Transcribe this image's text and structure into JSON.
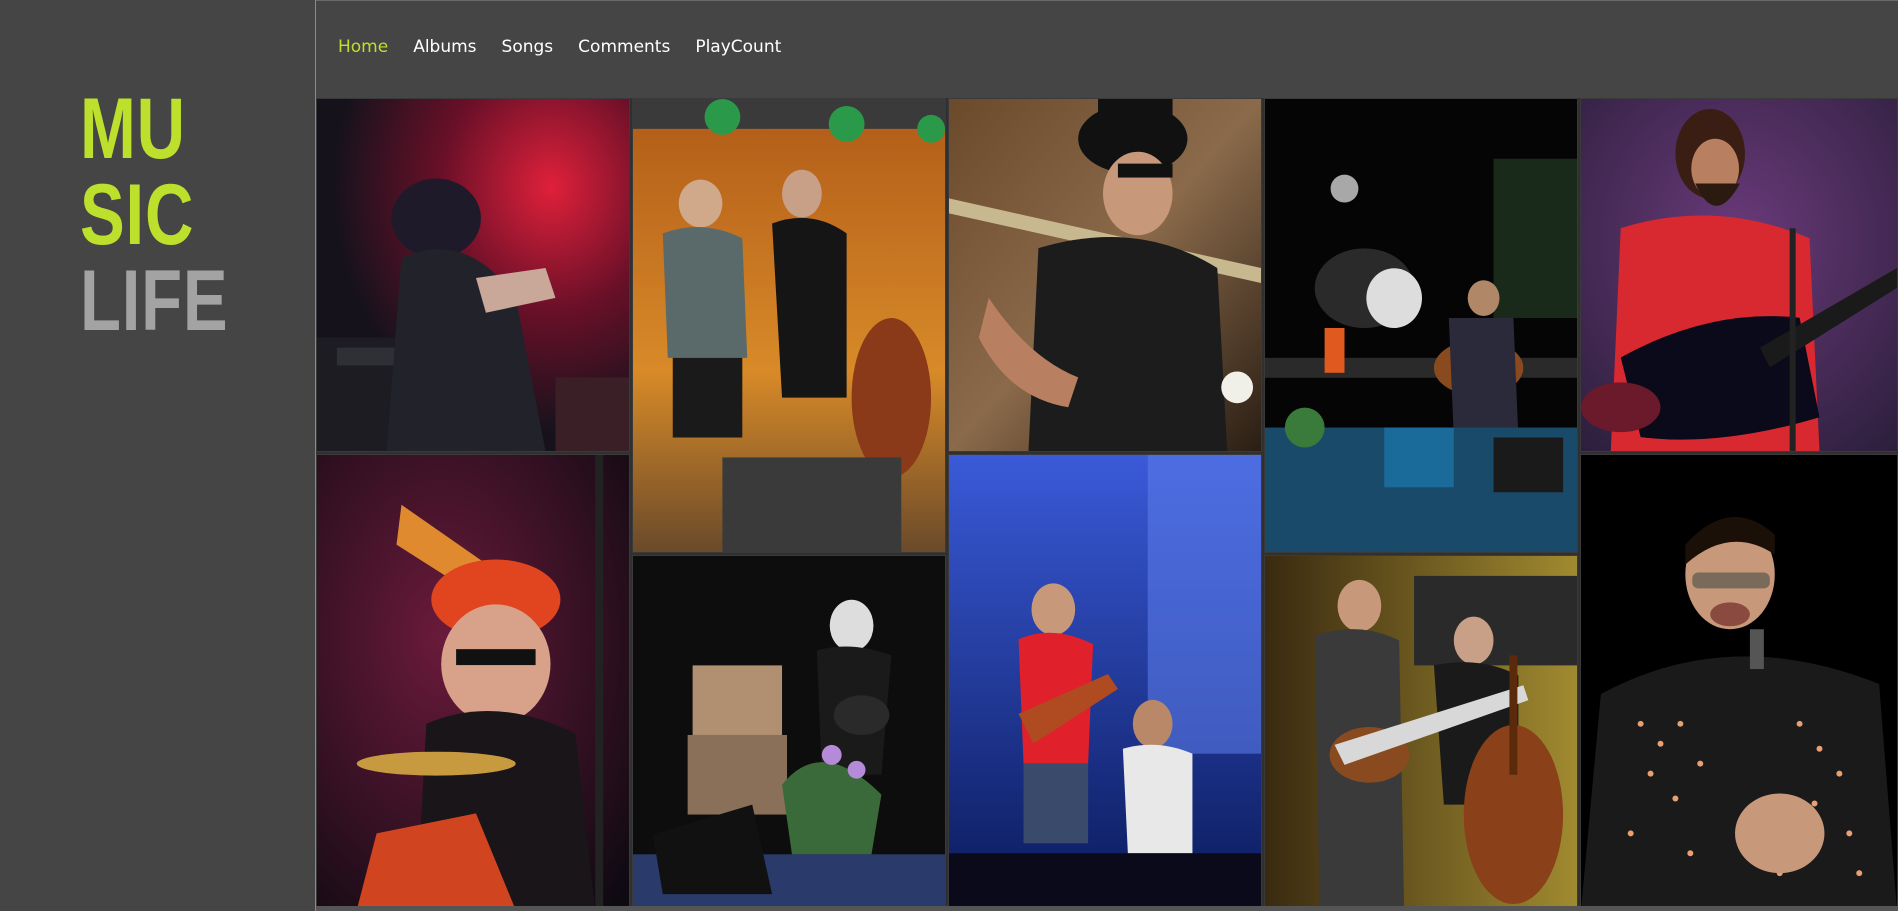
{
  "logo": {
    "line1": "MU",
    "line2": "SIC",
    "line3": "LIFE"
  },
  "nav": {
    "items": [
      {
        "label": "Home",
        "active": true
      },
      {
        "label": "Albums",
        "active": false
      },
      {
        "label": "Songs",
        "active": false
      },
      {
        "label": "Comments",
        "active": false
      },
      {
        "label": "PlayCount",
        "active": false
      }
    ]
  },
  "colors": {
    "accent": "#bde02c",
    "sidebar": "#454545",
    "muted": "#a3a3a3"
  },
  "gallery": {
    "photos": [
      {
        "name": "singer-leather-jacket-red-stage-photo"
      },
      {
        "name": "rockabilly-duo-bass-stage-photo"
      },
      {
        "name": "hat-singer-guitar-photo"
      },
      {
        "name": "band-drums-acoustic-guitar-photo"
      },
      {
        "name": "bearded-guitarist-red-shirt-photo"
      },
      {
        "name": "drummer-orange-hat-photo"
      },
      {
        "name": "guitarist-white-hair-stage-photo"
      },
      {
        "name": "red-shirt-guitarist-blue-curtain-photo"
      },
      {
        "name": "guitar-and-double-bass-duo-photo"
      },
      {
        "name": "singer-sunglasses-sparkle-jacket-photo"
      }
    ]
  }
}
